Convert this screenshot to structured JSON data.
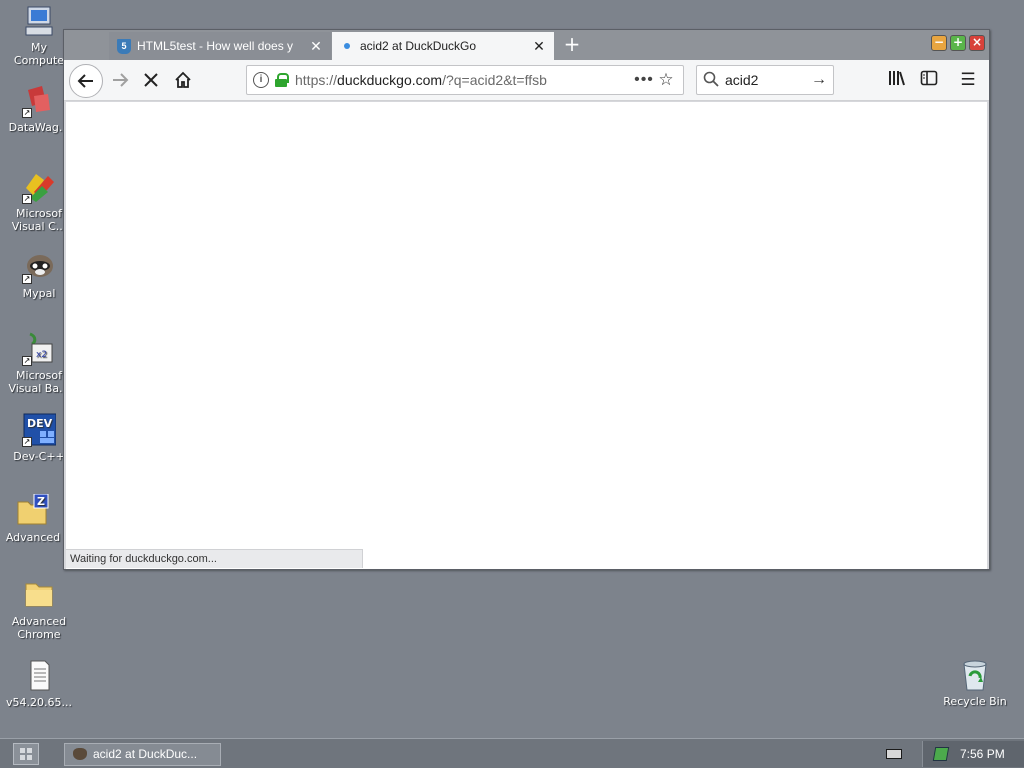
{
  "desktop": {
    "icons": [
      {
        "label": "My\nCompute",
        "icon": "computer-icon"
      },
      {
        "label": "DataWag...",
        "icon": "datawag-icon"
      },
      {
        "label": "Microsof\nVisual C...",
        "icon": "visual-c-icon"
      },
      {
        "label": "Mypal",
        "icon": "mypal-icon"
      },
      {
        "label": "Microsof\nVisual Ba...",
        "icon": "visual-basic-icon"
      },
      {
        "label": "Dev-C++",
        "icon": "devcpp-icon"
      },
      {
        "label": "Advanced",
        "icon": "advanced-zip-icon"
      },
      {
        "label": "Advanced\nChrome",
        "icon": "folder-icon"
      },
      {
        "label": "v54.20.65...",
        "icon": "text-file-icon"
      },
      {
        "label": "Recycle Bin",
        "icon": "recycle-bin-icon"
      }
    ]
  },
  "browser": {
    "tabs": [
      {
        "label": "HTML5test - How well does y",
        "icon": "html5-icon",
        "active": false
      },
      {
        "label": "acid2 at DuckDuckGo",
        "icon": "loading-dot-icon",
        "active": true
      }
    ],
    "new_tab": "+",
    "url": {
      "prefix": "https://",
      "host": "duckduckgo.com",
      "path": "/?q=acid2&t=ffsb"
    },
    "search": {
      "query": "acid2"
    },
    "status": "Waiting for duckduckgo.com..."
  },
  "taskbar": {
    "task_label": "acid2 at DuckDuc...",
    "clock": "7:56 PM"
  },
  "colors": {
    "desktop": "#7d838c",
    "lock": "#2ea52e",
    "taskbar": "#6f757d"
  }
}
